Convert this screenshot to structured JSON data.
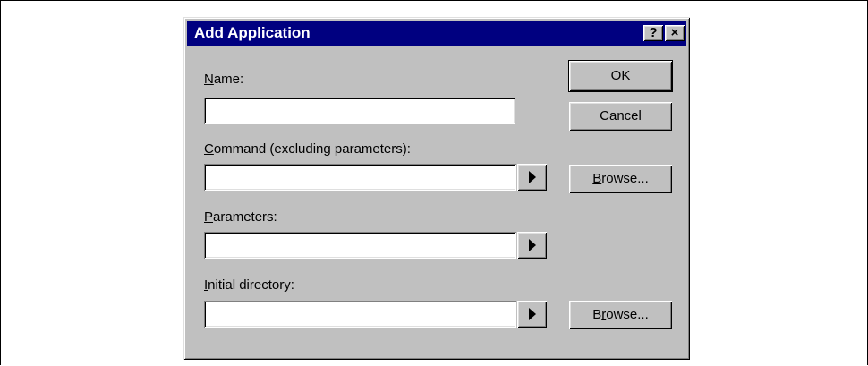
{
  "dialog": {
    "title": "Add Application",
    "help_glyph": "?",
    "close_glyph": "×"
  },
  "fields": {
    "name": {
      "label_mnemonic": "N",
      "label_rest": "ame:",
      "value": ""
    },
    "command": {
      "label_mnemonic": "C",
      "label_rest": "ommand (excluding parameters):",
      "value": ""
    },
    "parameters": {
      "label_mnemonic": "P",
      "label_rest": "arameters:",
      "value": ""
    },
    "initial_directory": {
      "label_mnemonic": "I",
      "label_rest": "nitial directory:",
      "value": ""
    }
  },
  "buttons": {
    "ok": "OK",
    "cancel": "Cancel",
    "browse_command": {
      "mnemonic": "B",
      "rest": "rowse..."
    },
    "browse_directory": {
      "pre": "B",
      "mnemonic": "r",
      "rest": "owse..."
    }
  },
  "icons": [
    "help-icon",
    "close-icon",
    "arrow-right-icon"
  ],
  "colors": {
    "titlebar": "#000080",
    "dialog_face": "#c0c0c0",
    "field_bg": "#ffffff"
  }
}
